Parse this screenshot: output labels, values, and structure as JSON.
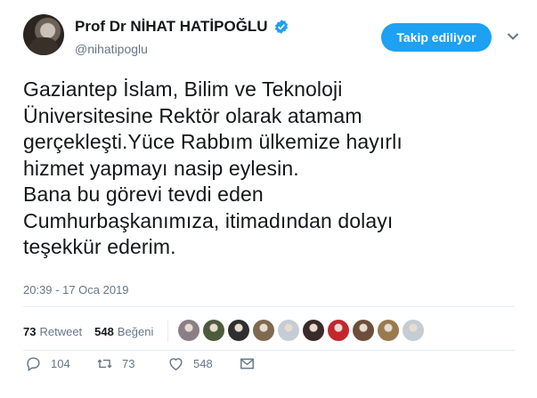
{
  "user": {
    "display_name": "Prof Dr NİHAT HATİPOĞLU",
    "handle": "@nihatipoglu",
    "verified": true
  },
  "follow_button": {
    "label": "Takip ediliyor",
    "color": "#1da1f2"
  },
  "tweet": {
    "text": "Gaziantep İslam, Bilim ve Teknoloji\nÜniversitesine Rektör olarak atamam\ngerçekleşti.Yüce Rabbım ülkemize hayırlı\nhizmet yapmayı nasip eylesin.\nBana bu görevi tevdi eden\nCumhurbaşkanımıza, itimadından dolayı\nteşekkür ederim.",
    "timestamp": "20:39 - 17 Oca 2019"
  },
  "stats": {
    "retweets_count": "73",
    "retweets_label": "Retweet",
    "likes_count": "548",
    "likes_label": "Beğeni"
  },
  "likers": [
    {
      "color": "#8a7f86"
    },
    {
      "color": "#4d5a3c"
    },
    {
      "color": "#2f2f2f"
    },
    {
      "color": "#7d6a4f"
    },
    {
      "color": "#c5ccd3"
    },
    {
      "color": "#3a2a2a"
    },
    {
      "color": "#c2272d"
    },
    {
      "color": "#6b4f3b"
    },
    {
      "color": "#9a7a4d"
    },
    {
      "color": "#c5ccd3"
    }
  ],
  "actions": {
    "replies": "104",
    "retweets": "73",
    "likes": "548"
  },
  "icons": {
    "verified": "verified-badge-icon",
    "caret": "chevron-down-icon",
    "reply": "reply-icon",
    "retweet": "retweet-icon",
    "like": "heart-icon",
    "dm": "envelope-icon"
  }
}
